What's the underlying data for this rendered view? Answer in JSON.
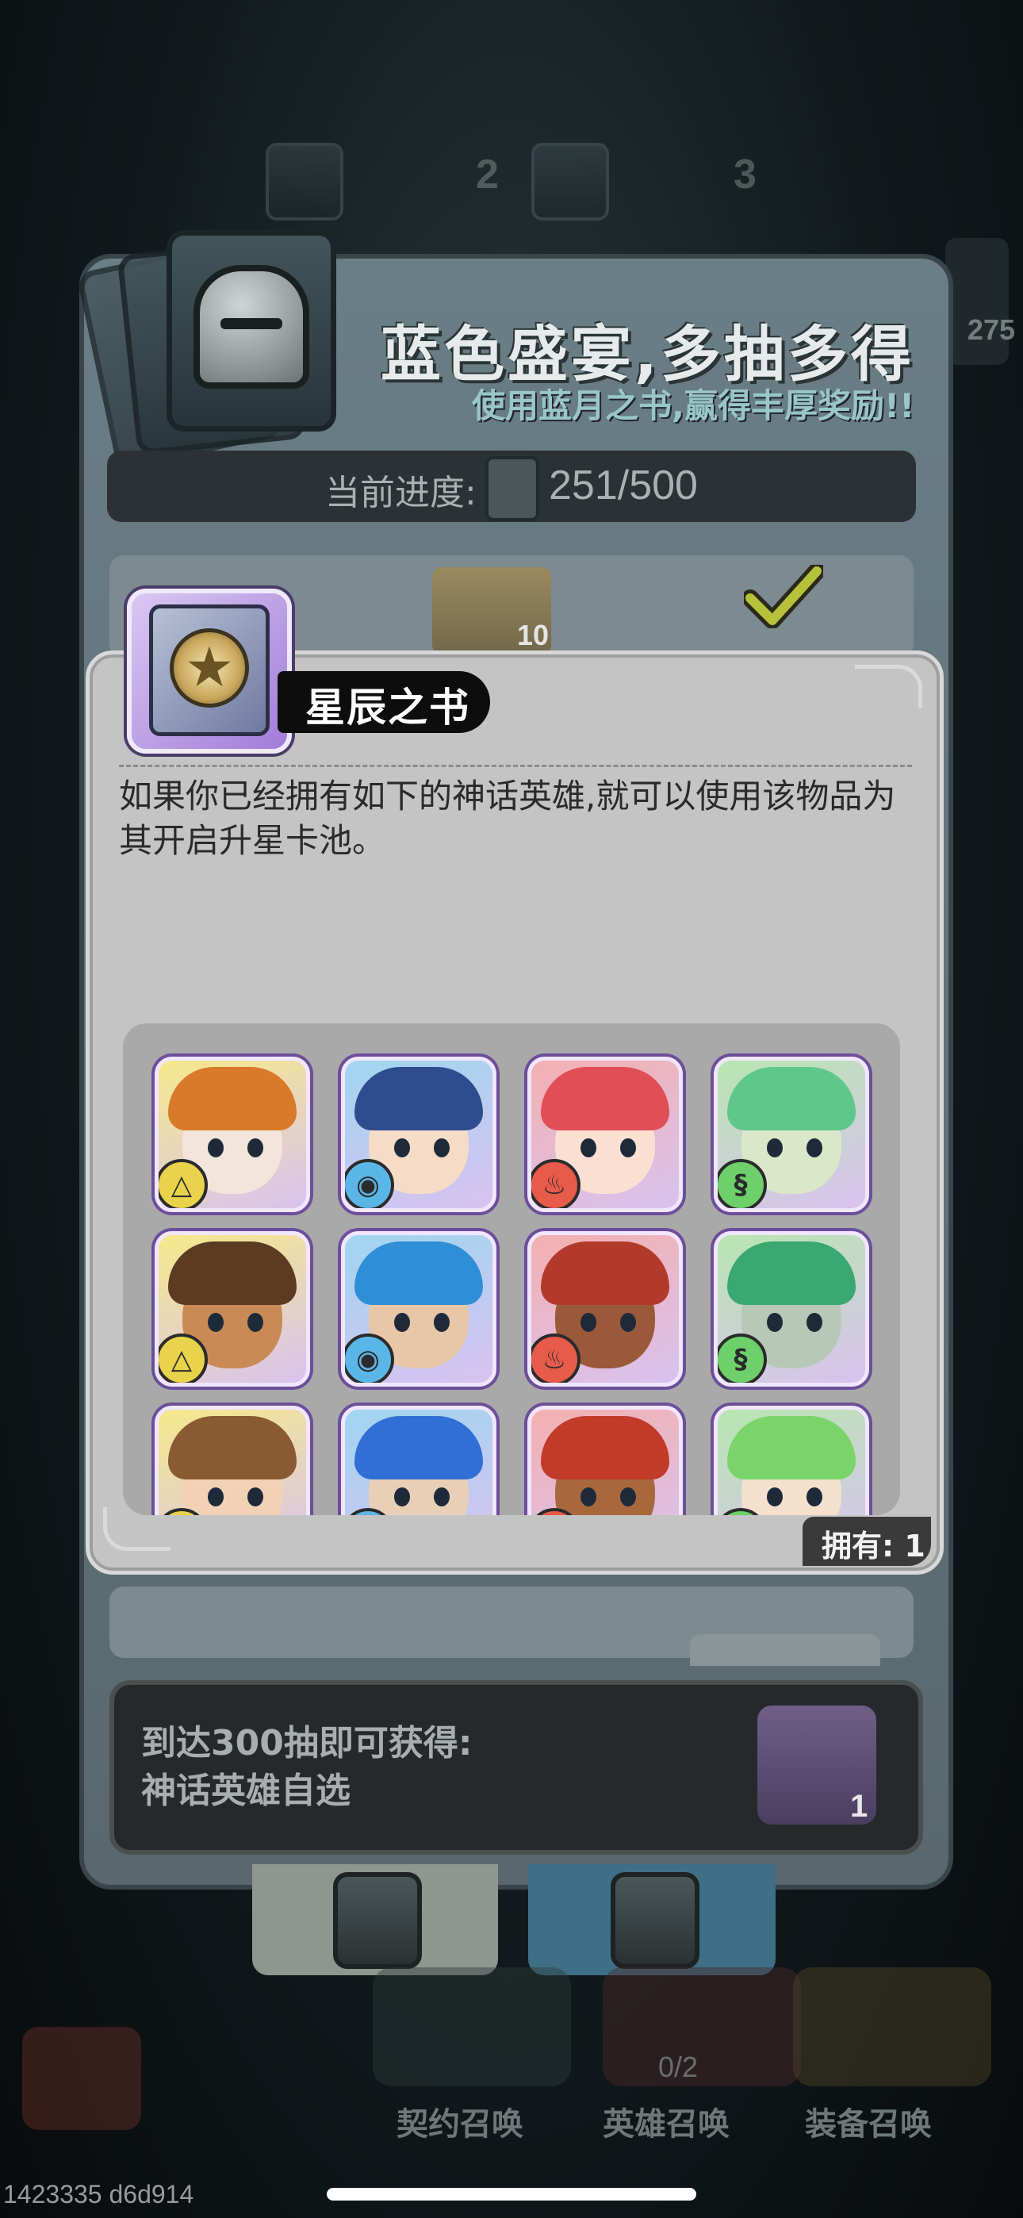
{
  "event": {
    "title": "蓝色盛宴,多抽多得",
    "subtitle": "使用蓝月之书,赢得丰厚奖励!!",
    "progress_label": "当前进度:",
    "progress_value": "251/500",
    "reward_qty": "10",
    "side_count": "275"
  },
  "tabs_top": [
    "2",
    "3"
  ],
  "popup": {
    "item_name": "星辰之书",
    "description": "如果你已经拥有如下的神话英雄,就可以使用该物品为其开启升星卡池。",
    "owned_label": "拥有: 1",
    "heroes": [
      {
        "name": "tiger-hero",
        "element": "earth",
        "element_color": "#e8d34a",
        "skin": "#f1e6d9",
        "hair": "#d97a2b",
        "bg": "#f6e98a"
      },
      {
        "name": "gold-crown-hero",
        "element": "water",
        "element_color": "#5bb6e8",
        "skin": "#f6dcc6",
        "hair": "#2f4c8f",
        "bg": "#9fd6f0"
      },
      {
        "name": "red-hair-hero",
        "element": "fire",
        "element_color": "#e85a4a",
        "skin": "#fbe0d2",
        "hair": "#e24e58",
        "bg": "#f4b0b0"
      },
      {
        "name": "green-hair-hero",
        "element": "wind",
        "element_color": "#6ed06a",
        "skin": "#dbe8c8",
        "hair": "#5fc78a",
        "bg": "#b8e6b0"
      },
      {
        "name": "goggles-hero",
        "element": "earth",
        "element_color": "#e8d34a",
        "skin": "#c98a55",
        "hair": "#5c3b22",
        "bg": "#f6e98a"
      },
      {
        "name": "blue-hair-hero",
        "element": "water",
        "element_color": "#5bb6e8",
        "skin": "#e8c6a8",
        "hair": "#2f8fd6",
        "bg": "#9fd6f0"
      },
      {
        "name": "pilot-hero",
        "element": "fire",
        "element_color": "#e85a4a",
        "skin": "#9a5a3a",
        "hair": "#b23a2a",
        "bg": "#f4b0b0"
      },
      {
        "name": "leaf-hero",
        "element": "wind",
        "element_color": "#6ed06a",
        "skin": "#b8c8b8",
        "hair": "#3aa870",
        "bg": "#b8e6b0"
      },
      {
        "name": "tiara-hero",
        "element": "earth",
        "element_color": "#e8d34a",
        "skin": "#f1d2b6",
        "hair": "#8a5a32",
        "bg": "#f6e98a"
      },
      {
        "name": "elf-hero",
        "element": "water",
        "element_color": "#5bb6e8",
        "skin": "#e9cfb8",
        "hair": "#2f6fd6",
        "bg": "#9fd6f0"
      },
      {
        "name": "warrior-hero",
        "element": "fire",
        "element_color": "#e85a4a",
        "skin": "#a8683e",
        "hair": "#c23a2a",
        "bg": "#f4b0b0"
      },
      {
        "name": "green-girl-hero",
        "element": "wind",
        "element_color": "#6ed06a",
        "skin": "#f4e0cc",
        "hair": "#7ad46a",
        "bg": "#b8e6b0"
      }
    ]
  },
  "milestone": {
    "line1": "到达300抽即可获得:",
    "line2": "神话英雄自选",
    "reward_qty": "1"
  },
  "bottom_nav": {
    "items": [
      "契约召唤",
      "英雄召唤",
      "装备召唤"
    ],
    "hero_progress": "0/2"
  },
  "build_id": "1423335 d6d914",
  "colors": {
    "popup_bg": "#c4c4c4",
    "title_tag": "#0d0d0d",
    "rarity_border": "#6c4e9a"
  }
}
